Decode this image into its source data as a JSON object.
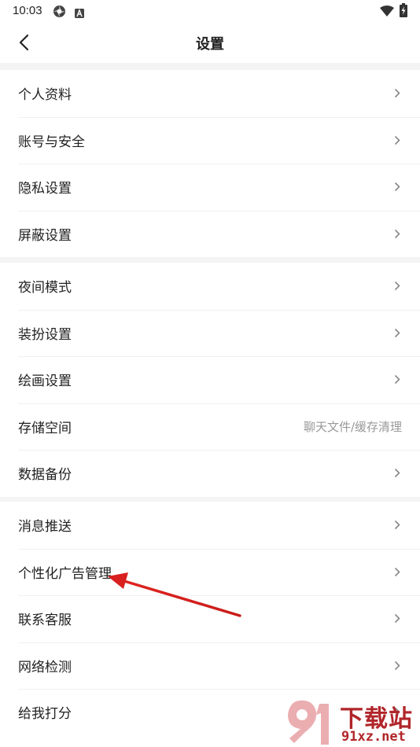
{
  "status_bar": {
    "time": "10:03"
  },
  "header": {
    "title": "设置"
  },
  "groups": [
    {
      "items": [
        {
          "label": "个人资料"
        },
        {
          "label": "账号与安全"
        },
        {
          "label": "隐私设置"
        },
        {
          "label": "屏蔽设置"
        }
      ]
    },
    {
      "items": [
        {
          "label": "夜间模式"
        },
        {
          "label": "装扮设置"
        },
        {
          "label": "绘画设置"
        },
        {
          "label": "存储空间",
          "hint": "聊天文件/缓存清理"
        },
        {
          "label": "数据备份"
        }
      ]
    },
    {
      "items": [
        {
          "label": "消息推送"
        },
        {
          "label": "个性化广告管理"
        },
        {
          "label": "联系客服"
        },
        {
          "label": "网络检测"
        },
        {
          "label": "给我打分"
        }
      ]
    }
  ],
  "watermark": {
    "top": "下载站",
    "bottom": "91xz.net"
  },
  "colors": {
    "annotation_arrow": "#d8201e",
    "separator_band": "#f4f4f4",
    "chevron": "#888888"
  }
}
